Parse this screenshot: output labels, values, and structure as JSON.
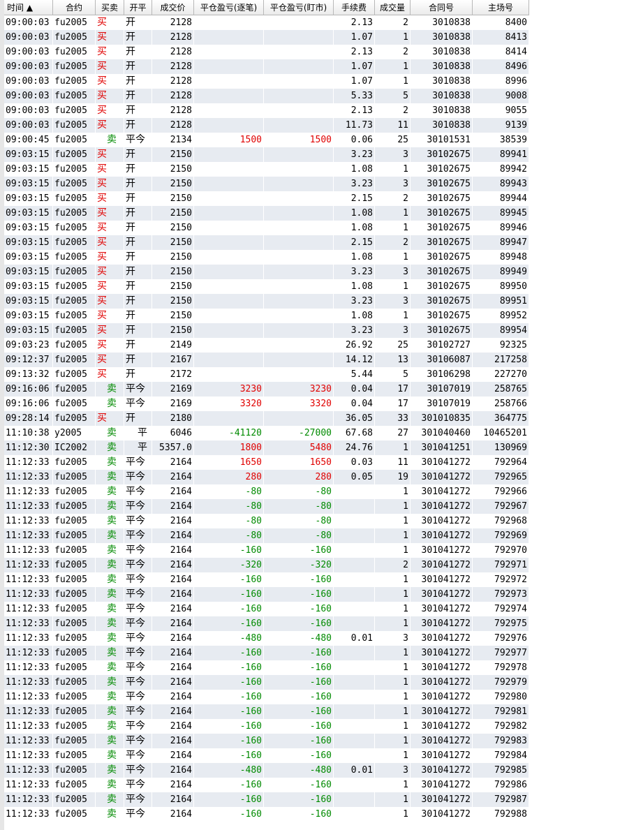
{
  "colors": {
    "buy": "#e00000",
    "sell": "#008a00",
    "profit": "#e00000",
    "loss": "#008a00",
    "row_alt": "#e7ebf1"
  },
  "columns": [
    {
      "key": "time",
      "label": "时间 ▲",
      "width": 70,
      "align": "l"
    },
    {
      "key": "contract",
      "label": "合约",
      "width": 61,
      "align": "l"
    },
    {
      "key": "side",
      "label": "买卖",
      "width": 41,
      "align": "l"
    },
    {
      "key": "oc",
      "label": "开平",
      "width": 40,
      "align": "l"
    },
    {
      "key": "price",
      "label": "成交价",
      "width": 60,
      "align": "r"
    },
    {
      "key": "pnl_trade",
      "label": "平仓盈亏(逐笔)",
      "width": 100,
      "align": "r"
    },
    {
      "key": "pnl_mark",
      "label": "平仓盈亏(盯市)",
      "width": 100,
      "align": "r"
    },
    {
      "key": "fee",
      "label": "手续费",
      "width": 59,
      "align": "r"
    },
    {
      "key": "qty",
      "label": "成交量",
      "width": 51,
      "align": "r"
    },
    {
      "key": "order",
      "label": "合同号",
      "width": 89,
      "align": "r"
    },
    {
      "key": "serial",
      "label": "主场号",
      "width": 81,
      "align": "r"
    }
  ],
  "rows": [
    [
      "09:00:03",
      "fu2005",
      "买",
      "开",
      "2128",
      "",
      "",
      "2.13",
      "2",
      "3010838",
      "8400"
    ],
    [
      "09:00:03",
      "fu2005",
      "买",
      "开",
      "2128",
      "",
      "",
      "1.07",
      "1",
      "3010838",
      "8413"
    ],
    [
      "09:00:03",
      "fu2005",
      "买",
      "开",
      "2128",
      "",
      "",
      "2.13",
      "2",
      "3010838",
      "8414"
    ],
    [
      "09:00:03",
      "fu2005",
      "买",
      "开",
      "2128",
      "",
      "",
      "1.07",
      "1",
      "3010838",
      "8496"
    ],
    [
      "09:00:03",
      "fu2005",
      "买",
      "开",
      "2128",
      "",
      "",
      "1.07",
      "1",
      "3010838",
      "8996"
    ],
    [
      "09:00:03",
      "fu2005",
      "买",
      "开",
      "2128",
      "",
      "",
      "5.33",
      "5",
      "3010838",
      "9008"
    ],
    [
      "09:00:03",
      "fu2005",
      "买",
      "开",
      "2128",
      "",
      "",
      "2.13",
      "2",
      "3010838",
      "9055"
    ],
    [
      "09:00:03",
      "fu2005",
      "买",
      "开",
      "2128",
      "",
      "",
      "11.73",
      "11",
      "3010838",
      "9139"
    ],
    [
      "09:00:45",
      "fu2005",
      "卖",
      "平今",
      "2134",
      "1500",
      "1500",
      "0.06",
      "25",
      "30101531",
      "38539"
    ],
    [
      "09:03:15",
      "fu2005",
      "买",
      "开",
      "2150",
      "",
      "",
      "3.23",
      "3",
      "30102675",
      "89941"
    ],
    [
      "09:03:15",
      "fu2005",
      "买",
      "开",
      "2150",
      "",
      "",
      "1.08",
      "1",
      "30102675",
      "89942"
    ],
    [
      "09:03:15",
      "fu2005",
      "买",
      "开",
      "2150",
      "",
      "",
      "3.23",
      "3",
      "30102675",
      "89943"
    ],
    [
      "09:03:15",
      "fu2005",
      "买",
      "开",
      "2150",
      "",
      "",
      "2.15",
      "2",
      "30102675",
      "89944"
    ],
    [
      "09:03:15",
      "fu2005",
      "买",
      "开",
      "2150",
      "",
      "",
      "1.08",
      "1",
      "30102675",
      "89945"
    ],
    [
      "09:03:15",
      "fu2005",
      "买",
      "开",
      "2150",
      "",
      "",
      "1.08",
      "1",
      "30102675",
      "89946"
    ],
    [
      "09:03:15",
      "fu2005",
      "买",
      "开",
      "2150",
      "",
      "",
      "2.15",
      "2",
      "30102675",
      "89947"
    ],
    [
      "09:03:15",
      "fu2005",
      "买",
      "开",
      "2150",
      "",
      "",
      "1.08",
      "1",
      "30102675",
      "89948"
    ],
    [
      "09:03:15",
      "fu2005",
      "买",
      "开",
      "2150",
      "",
      "",
      "3.23",
      "3",
      "30102675",
      "89949"
    ],
    [
      "09:03:15",
      "fu2005",
      "买",
      "开",
      "2150",
      "",
      "",
      "1.08",
      "1",
      "30102675",
      "89950"
    ],
    [
      "09:03:15",
      "fu2005",
      "买",
      "开",
      "2150",
      "",
      "",
      "3.23",
      "3",
      "30102675",
      "89951"
    ],
    [
      "09:03:15",
      "fu2005",
      "买",
      "开",
      "2150",
      "",
      "",
      "1.08",
      "1",
      "30102675",
      "89952"
    ],
    [
      "09:03:15",
      "fu2005",
      "买",
      "开",
      "2150",
      "",
      "",
      "3.23",
      "3",
      "30102675",
      "89954"
    ],
    [
      "09:03:23",
      "fu2005",
      "买",
      "开",
      "2149",
      "",
      "",
      "26.92",
      "25",
      "30102727",
      "92325"
    ],
    [
      "09:12:37",
      "fu2005",
      "买",
      "开",
      "2167",
      "",
      "",
      "14.12",
      "13",
      "30106087",
      "217258"
    ],
    [
      "09:13:32",
      "fu2005",
      "买",
      "开",
      "2172",
      "",
      "",
      "5.44",
      "5",
      "30106298",
      "227270"
    ],
    [
      "09:16:06",
      "fu2005",
      "卖",
      "平今",
      "2169",
      "3230",
      "3230",
      "0.04",
      "17",
      "30107019",
      "258765"
    ],
    [
      "09:16:06",
      "fu2005",
      "卖",
      "平今",
      "2169",
      "3320",
      "3320",
      "0.04",
      "17",
      "30107019",
      "258766"
    ],
    [
      "09:28:14",
      "fu2005",
      "买",
      "开",
      "2180",
      "",
      "",
      "36.05",
      "33",
      "301010835",
      "364775"
    ],
    [
      "11:10:38",
      "y2005",
      "卖",
      "平",
      "6046",
      "-41120",
      "-27000",
      "67.68",
      "27",
      "301040460",
      "10465201"
    ],
    [
      "11:12:30",
      "IC2002",
      "卖",
      "平",
      "5357.0",
      "1800",
      "5480",
      "24.76",
      "1",
      "301041251",
      "130969"
    ],
    [
      "11:12:33",
      "fu2005",
      "卖",
      "平今",
      "2164",
      "1650",
      "1650",
      "0.03",
      "11",
      "301041272",
      "792964"
    ],
    [
      "11:12:33",
      "fu2005",
      "卖",
      "平今",
      "2164",
      "280",
      "280",
      "0.05",
      "19",
      "301041272",
      "792965"
    ],
    [
      "11:12:33",
      "fu2005",
      "卖",
      "平今",
      "2164",
      "-80",
      "-80",
      "",
      "1",
      "301041272",
      "792966"
    ],
    [
      "11:12:33",
      "fu2005",
      "卖",
      "平今",
      "2164",
      "-80",
      "-80",
      "",
      "1",
      "301041272",
      "792967"
    ],
    [
      "11:12:33",
      "fu2005",
      "卖",
      "平今",
      "2164",
      "-80",
      "-80",
      "",
      "1",
      "301041272",
      "792968"
    ],
    [
      "11:12:33",
      "fu2005",
      "卖",
      "平今",
      "2164",
      "-80",
      "-80",
      "",
      "1",
      "301041272",
      "792969"
    ],
    [
      "11:12:33",
      "fu2005",
      "卖",
      "平今",
      "2164",
      "-160",
      "-160",
      "",
      "1",
      "301041272",
      "792970"
    ],
    [
      "11:12:33",
      "fu2005",
      "卖",
      "平今",
      "2164",
      "-320",
      "-320",
      "",
      "2",
      "301041272",
      "792971"
    ],
    [
      "11:12:33",
      "fu2005",
      "卖",
      "平今",
      "2164",
      "-160",
      "-160",
      "",
      "1",
      "301041272",
      "792972"
    ],
    [
      "11:12:33",
      "fu2005",
      "卖",
      "平今",
      "2164",
      "-160",
      "-160",
      "",
      "1",
      "301041272",
      "792973"
    ],
    [
      "11:12:33",
      "fu2005",
      "卖",
      "平今",
      "2164",
      "-160",
      "-160",
      "",
      "1",
      "301041272",
      "792974"
    ],
    [
      "11:12:33",
      "fu2005",
      "卖",
      "平今",
      "2164",
      "-160",
      "-160",
      "",
      "1",
      "301041272",
      "792975"
    ],
    [
      "11:12:33",
      "fu2005",
      "卖",
      "平今",
      "2164",
      "-480",
      "-480",
      "0.01",
      "3",
      "301041272",
      "792976"
    ],
    [
      "11:12:33",
      "fu2005",
      "卖",
      "平今",
      "2164",
      "-160",
      "-160",
      "",
      "1",
      "301041272",
      "792977"
    ],
    [
      "11:12:33",
      "fu2005",
      "卖",
      "平今",
      "2164",
      "-160",
      "-160",
      "",
      "1",
      "301041272",
      "792978"
    ],
    [
      "11:12:33",
      "fu2005",
      "卖",
      "平今",
      "2164",
      "-160",
      "-160",
      "",
      "1",
      "301041272",
      "792979"
    ],
    [
      "11:12:33",
      "fu2005",
      "卖",
      "平今",
      "2164",
      "-160",
      "-160",
      "",
      "1",
      "301041272",
      "792980"
    ],
    [
      "11:12:33",
      "fu2005",
      "卖",
      "平今",
      "2164",
      "-160",
      "-160",
      "",
      "1",
      "301041272",
      "792981"
    ],
    [
      "11:12:33",
      "fu2005",
      "卖",
      "平今",
      "2164",
      "-160",
      "-160",
      "",
      "1",
      "301041272",
      "792982"
    ],
    [
      "11:12:33",
      "fu2005",
      "卖",
      "平今",
      "2164",
      "-160",
      "-160",
      "",
      "1",
      "301041272",
      "792983"
    ],
    [
      "11:12:33",
      "fu2005",
      "卖",
      "平今",
      "2164",
      "-160",
      "-160",
      "",
      "1",
      "301041272",
      "792984"
    ],
    [
      "11:12:33",
      "fu2005",
      "卖",
      "平今",
      "2164",
      "-480",
      "-480",
      "0.01",
      "3",
      "301041272",
      "792985"
    ],
    [
      "11:12:33",
      "fu2005",
      "卖",
      "平今",
      "2164",
      "-160",
      "-160",
      "",
      "1",
      "301041272",
      "792986"
    ],
    [
      "11:12:33",
      "fu2005",
      "卖",
      "平今",
      "2164",
      "-160",
      "-160",
      "",
      "1",
      "301041272",
      "792987"
    ],
    [
      "11:12:33",
      "fu2005",
      "卖",
      "平今",
      "2164",
      "-160",
      "-160",
      "",
      "1",
      "301041272",
      "792988"
    ]
  ]
}
